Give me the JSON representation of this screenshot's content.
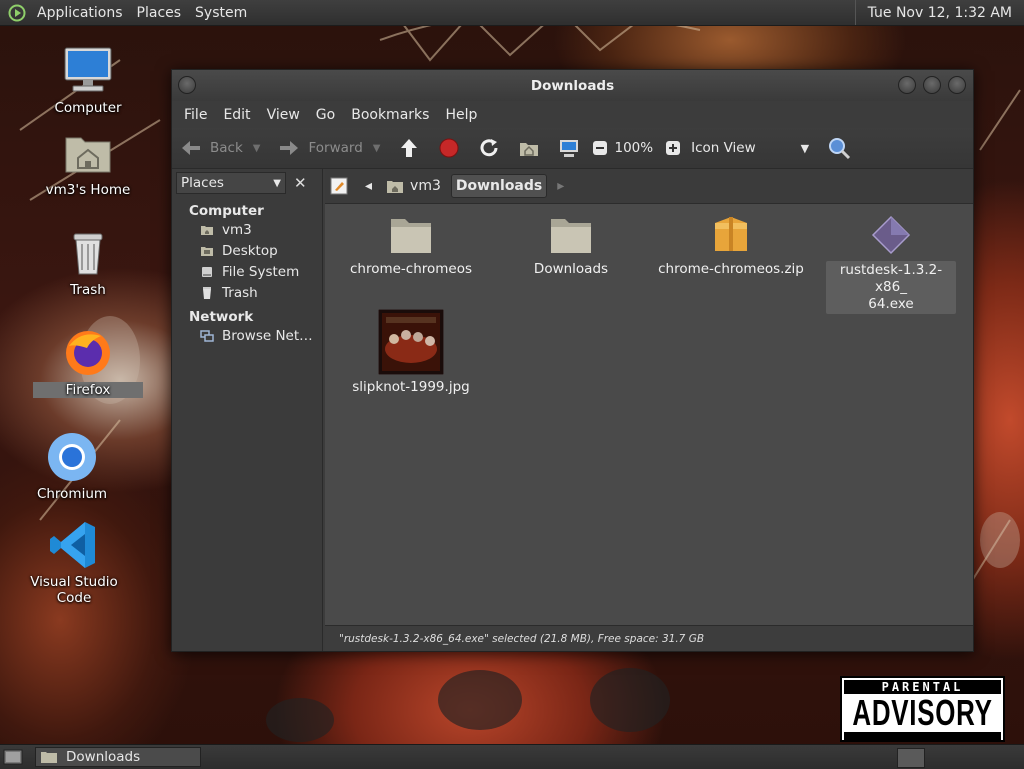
{
  "top_panel": {
    "menus": [
      "Applications",
      "Places",
      "System"
    ],
    "clock": "Tue Nov 12,  1:32 AM"
  },
  "desktop": {
    "icons": [
      {
        "label": "Computer",
        "icon": "computer-icon"
      },
      {
        "label": "vm3's Home",
        "icon": "home-folder-icon"
      },
      {
        "label": "Trash",
        "icon": "trash-icon"
      },
      {
        "label": "Firefox",
        "icon": "firefox-icon"
      },
      {
        "label": "Chromium",
        "icon": "chromium-icon"
      },
      {
        "label": "Visual Studio Code",
        "icon": "vscode-icon"
      }
    ]
  },
  "window": {
    "title": "Downloads",
    "menus": [
      "File",
      "Edit",
      "View",
      "Go",
      "Bookmarks",
      "Help"
    ],
    "toolbar": {
      "back": "Back",
      "forward": "Forward",
      "zoom": "100%",
      "view_mode": "Icon View"
    },
    "sidebar": {
      "selector": "Places",
      "sections": [
        {
          "heading": "Computer",
          "items": [
            "vm3",
            "Desktop",
            "File System",
            "Trash"
          ]
        },
        {
          "heading": "Network",
          "items": [
            "Browse Net…"
          ]
        }
      ]
    },
    "pathbar": {
      "crumbs": [
        "vm3",
        "Downloads"
      ]
    },
    "files": [
      {
        "name": "chrome-chromeos",
        "icon": "folder-icon"
      },
      {
        "name": "Downloads",
        "icon": "folder-icon"
      },
      {
        "name": "chrome-chromeos.zip",
        "icon": "archive-icon"
      },
      {
        "name": "rustdesk-1.3.2-x86_64.exe",
        "name_line1": "rustdesk-1.3.2-x86_",
        "name_line2": "64.exe",
        "icon": "executable-icon",
        "selected": true
      },
      {
        "name": "slipknot-1999.jpg",
        "icon": "image-thumbnail"
      }
    ],
    "status": "\"rustdesk-1.3.2-x86_64.exe\" selected (21.8 MB), Free space: 31.7 GB"
  },
  "bottom_panel": {
    "task": "Downloads"
  },
  "wallpaper": {
    "sticker_top": "PARENTAL",
    "sticker_main": "ADVISORY"
  },
  "colors": {
    "panel": "#2f2f2f",
    "window_bg": "#3c3c3c",
    "content_bg": "#4a4a4a",
    "folder": "#c9c5b4",
    "archive": "#e8a53a",
    "exe": "#6a5c8a"
  }
}
